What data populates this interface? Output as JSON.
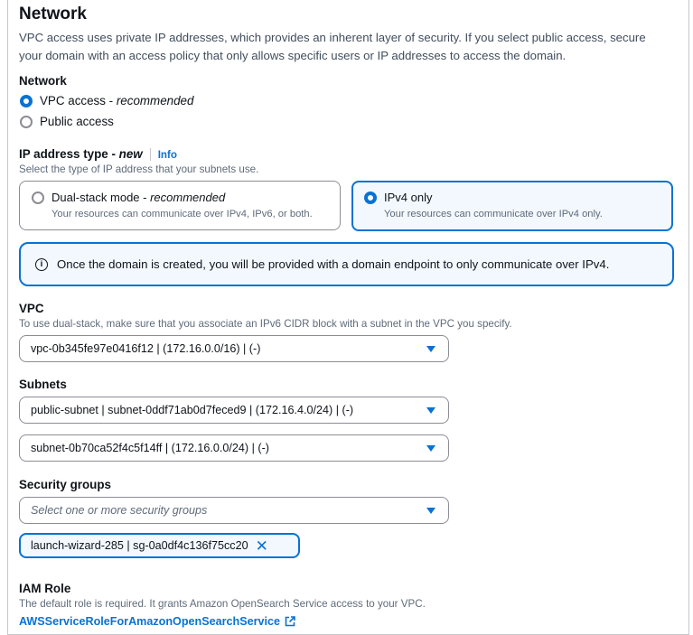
{
  "section": {
    "title": "Network",
    "description": "VPC access uses private IP addresses, which provides an inherent layer of security. If you select public access, secure your domain with an access policy that only allows specific users or IP addresses to access the domain."
  },
  "network": {
    "label": "Network",
    "options": [
      {
        "label": "VPC access - ",
        "suffix": "recommended",
        "selected": true
      },
      {
        "label": "Public access",
        "suffix": "",
        "selected": false
      }
    ]
  },
  "ip_type": {
    "label": "IP address type - ",
    "label_suffix": "new",
    "info": "Info",
    "description": "Select the type of IP address that your subnets use.",
    "tiles": [
      {
        "title": "Dual-stack mode - ",
        "title_suffix": "recommended",
        "subtitle": "Your resources can communicate over IPv4, IPv6, or both.",
        "selected": false
      },
      {
        "title": "IPv4 only",
        "title_suffix": "",
        "subtitle": "Your resources can communicate over IPv4 only.",
        "selected": true
      }
    ]
  },
  "alert": {
    "icon": "info-circle-icon",
    "text": "Once the domain is created, you will be provided with a domain endpoint to only communicate over IPv4."
  },
  "vpc": {
    "label": "VPC",
    "description": "To use dual-stack, make sure that you associate an IPv6 CIDR block with a subnet in the VPC you specify.",
    "value": "vpc-0b345fe97e0416f12 | (172.16.0.0/16) | (-)"
  },
  "subnets": {
    "label": "Subnets",
    "values": [
      "public-subnet | subnet-0ddf71ab0d7feced9 | (172.16.4.0/24) | (-)",
      "subnet-0b70ca52f4c5f14ff | (172.16.0.0/24) | (-)"
    ]
  },
  "security_groups": {
    "label": "Security groups",
    "placeholder": "Select one or more security groups",
    "token": "launch-wizard-285 | sg-0a0df4c136f75cc20"
  },
  "iam": {
    "label": "IAM Role",
    "description": "The default role is required. It grants Amazon OpenSearch Service access to your VPC.",
    "link": "AWSServiceRoleForAmazonOpenSearchService"
  },
  "colors": {
    "accent": "#0972d3",
    "text": "#0f141a",
    "secondary_text": "#5f6b7a",
    "selected_bg": "#f2f8fd"
  }
}
